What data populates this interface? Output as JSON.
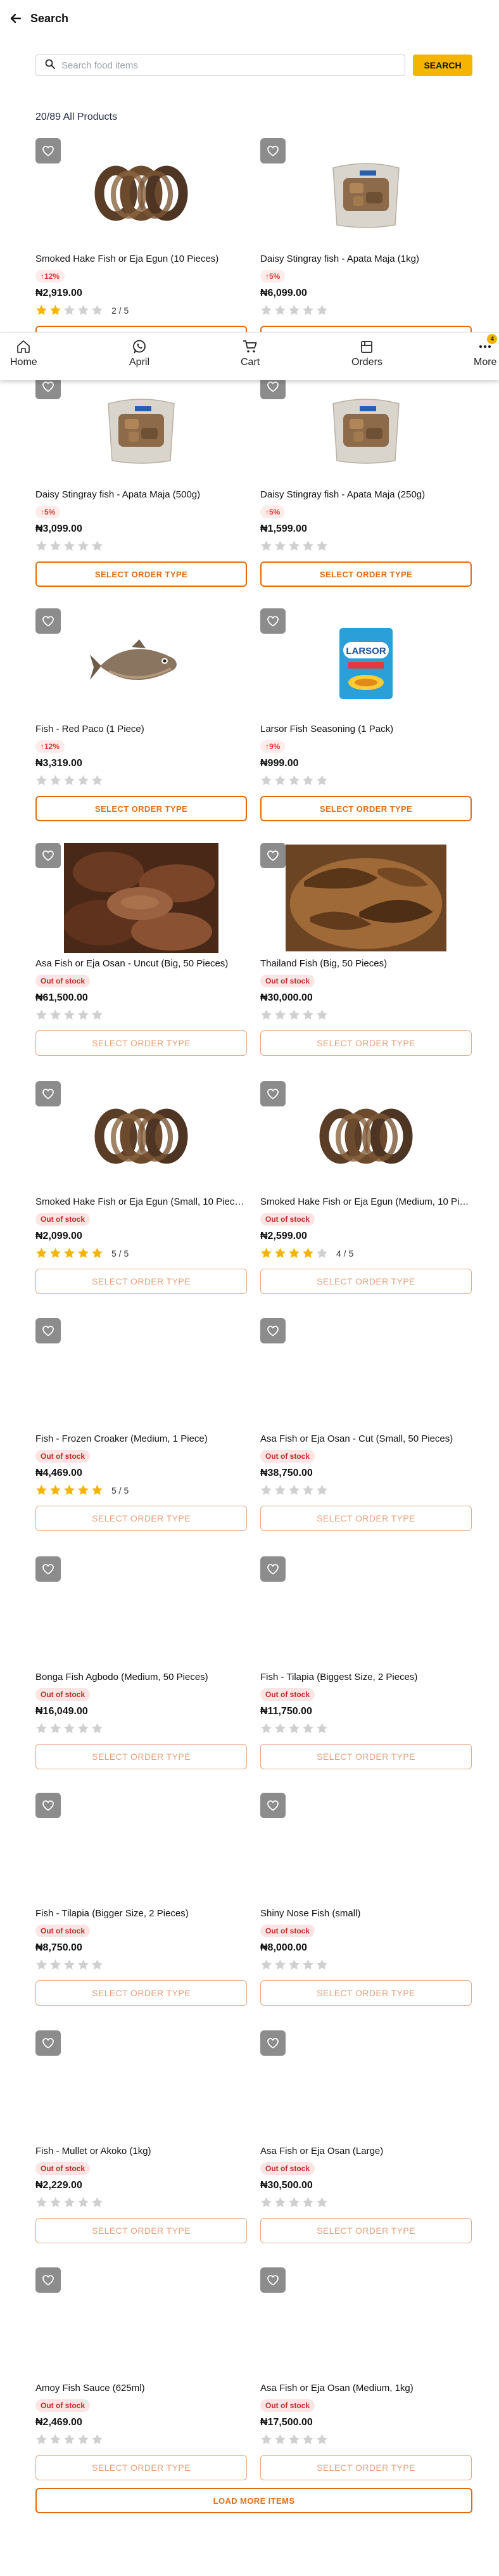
{
  "header": {
    "title": "Search"
  },
  "search": {
    "placeholder": "Search food items",
    "value": "",
    "button_label": "SEARCH"
  },
  "results": {
    "count_label": "20/89 All Products"
  },
  "colors": {
    "accent": "#f4b400",
    "cta": "#e06c10",
    "star": "#f4b400",
    "star_empty": "#d0d0d0",
    "price_up": "#e53935"
  },
  "bottom_nav": {
    "items": [
      {
        "label": "Home",
        "icon": "home-icon"
      },
      {
        "label": "April",
        "icon": "whatsapp-icon"
      },
      {
        "label": "Cart",
        "icon": "cart-icon"
      },
      {
        "label": "Orders",
        "icon": "orders-icon"
      },
      {
        "label": "More",
        "icon": "more-icon",
        "badge": "4"
      }
    ]
  },
  "products": [
    {
      "name": "Smoked Hake Fish or Eja Egun (10 Pieces)",
      "tag": "↑12%",
      "tag_type": "up",
      "price": "₦2,919.00",
      "rating": 2,
      "rating_text": "2 / 5",
      "button": "SELECT ORDER TYPE",
      "disabled": false,
      "image": "smoked-hake"
    },
    {
      "name": "Daisy Stingray fish - Apata Maja (1kg)",
      "tag": "↑5%",
      "tag_type": "up",
      "price": "₦6,099.00",
      "rating": 0,
      "rating_text": "",
      "button": "SELECT ORDER TYPE",
      "disabled": false,
      "image": "stingray-pack"
    },
    {
      "name": "Daisy Stingray fish - Apata Maja (500g)",
      "tag": "↑5%",
      "tag_type": "up",
      "price": "₦3,099.00",
      "rating": 0,
      "rating_text": "",
      "button": "SELECT ORDER TYPE",
      "disabled": false,
      "image": "stingray-pack"
    },
    {
      "name": "Daisy Stingray fish - Apata Maja (250g)",
      "tag": "↑5%",
      "tag_type": "up",
      "price": "₦1,599.00",
      "rating": 0,
      "rating_text": "",
      "button": "SELECT ORDER TYPE",
      "disabled": false,
      "image": "stingray-pack"
    },
    {
      "name": "Fish - Red Paco (1 Piece)",
      "tag": "↑12%",
      "tag_type": "up",
      "price": "₦3,319.00",
      "rating": 0,
      "rating_text": "",
      "button": "SELECT ORDER TYPE",
      "disabled": false,
      "image": "paco-fish"
    },
    {
      "name": "Larsor Fish Seasoning (1 Pack)",
      "tag": "↑9%",
      "tag_type": "up",
      "price": "₦999.00",
      "rating": 0,
      "rating_text": "",
      "button": "SELECT ORDER TYPE",
      "disabled": false,
      "image": "larsor-pack"
    },
    {
      "name": "Asa Fish or Eja Osan - Uncut (Big, 50 Pieces)",
      "tag": "Out of stock",
      "tag_type": "oos",
      "price": "₦61,500.00",
      "rating": 0,
      "rating_text": "",
      "button": "SELECT ORDER TYPE",
      "disabled": true,
      "image": "asa-fish"
    },
    {
      "name": "Thailand Fish (Big, 50 Pieces)",
      "tag": "Out of stock",
      "tag_type": "oos",
      "price": "₦30,000.00",
      "rating": 0,
      "rating_text": "",
      "button": "SELECT ORDER TYPE",
      "disabled": true,
      "image": "thailand-fish"
    },
    {
      "name": "Smoked Hake Fish or Eja Egun (Small, 10 Pieces)",
      "tag": "Out of stock",
      "tag_type": "oos",
      "price": "₦2,099.00",
      "rating": 5,
      "rating_text": "5 / 5",
      "button": "SELECT ORDER TYPE",
      "disabled": true,
      "image": "smoked-hake"
    },
    {
      "name": "Smoked Hake Fish or Eja Egun (Medium, 10 Pie...",
      "tag": "Out of stock",
      "tag_type": "oos",
      "price": "₦2,599.00",
      "rating": 4,
      "rating_text": "4 / 5",
      "button": "SELECT ORDER TYPE",
      "disabled": true,
      "image": "smoked-hake"
    },
    {
      "name": "Fish - Frozen Croaker (Medium, 1 Piece)",
      "tag": "Out of stock",
      "tag_type": "oos",
      "price": "₦4,469.00",
      "rating": 5,
      "rating_text": "5 / 5",
      "button": "SELECT ORDER TYPE",
      "disabled": true,
      "image": "none"
    },
    {
      "name": "Asa Fish or Eja Osan - Cut (Small, 50 Pieces)",
      "tag": "Out of stock",
      "tag_type": "oos",
      "price": "₦38,750.00",
      "rating": 0,
      "rating_text": "",
      "button": "SELECT ORDER TYPE",
      "disabled": true,
      "image": "none"
    },
    {
      "name": "Bonga Fish Agbodo (Medium, 50 Pieces)",
      "tag": "Out of stock",
      "tag_type": "oos",
      "price": "₦16,049.00",
      "rating": 0,
      "rating_text": "",
      "button": "SELECT ORDER TYPE",
      "disabled": true,
      "image": "none"
    },
    {
      "name": "Fish - Tilapia (Biggest Size, 2 Pieces)",
      "tag": "Out of stock",
      "tag_type": "oos",
      "price": "₦11,750.00",
      "rating": 0,
      "rating_text": "",
      "button": "SELECT ORDER TYPE",
      "disabled": true,
      "image": "none"
    },
    {
      "name": "Fish - Tilapia (Bigger Size, 2 Pieces)",
      "tag": "Out of stock",
      "tag_type": "oos",
      "price": "₦8,750.00",
      "rating": 0,
      "rating_text": "",
      "button": "SELECT ORDER TYPE",
      "disabled": true,
      "image": "none"
    },
    {
      "name": "Shiny Nose Fish (small)",
      "tag": "Out of stock",
      "tag_type": "oos",
      "price": "₦8,000.00",
      "rating": 0,
      "rating_text": "",
      "button": "SELECT ORDER TYPE",
      "disabled": true,
      "image": "none"
    },
    {
      "name": "Fish - Mullet or Akoko (1kg)",
      "tag": "Out of stock",
      "tag_type": "oos",
      "price": "₦2,229.00",
      "rating": 0,
      "rating_text": "",
      "button": "SELECT ORDER TYPE",
      "disabled": true,
      "image": "none"
    },
    {
      "name": "Asa Fish or Eja Osan (Large)",
      "tag": "Out of stock",
      "tag_type": "oos",
      "price": "₦30,500.00",
      "rating": 0,
      "rating_text": "",
      "button": "SELECT ORDER TYPE",
      "disabled": true,
      "image": "none"
    },
    {
      "name": "Amoy Fish Sauce (625ml)",
      "tag": "Out of stock",
      "tag_type": "oos",
      "price": "₦2,469.00",
      "rating": 0,
      "rating_text": "",
      "button": "SELECT ORDER TYPE",
      "disabled": true,
      "image": "none"
    },
    {
      "name": "Asa Fish or Eja Osan (Medium, 1kg)",
      "tag": "Out of stock",
      "tag_type": "oos",
      "price": "₦17,500.00",
      "rating": 0,
      "rating_text": "",
      "button": "SELECT ORDER TYPE",
      "disabled": true,
      "image": "none"
    }
  ],
  "load_more": {
    "label": "LOAD MORE ITEMS"
  }
}
